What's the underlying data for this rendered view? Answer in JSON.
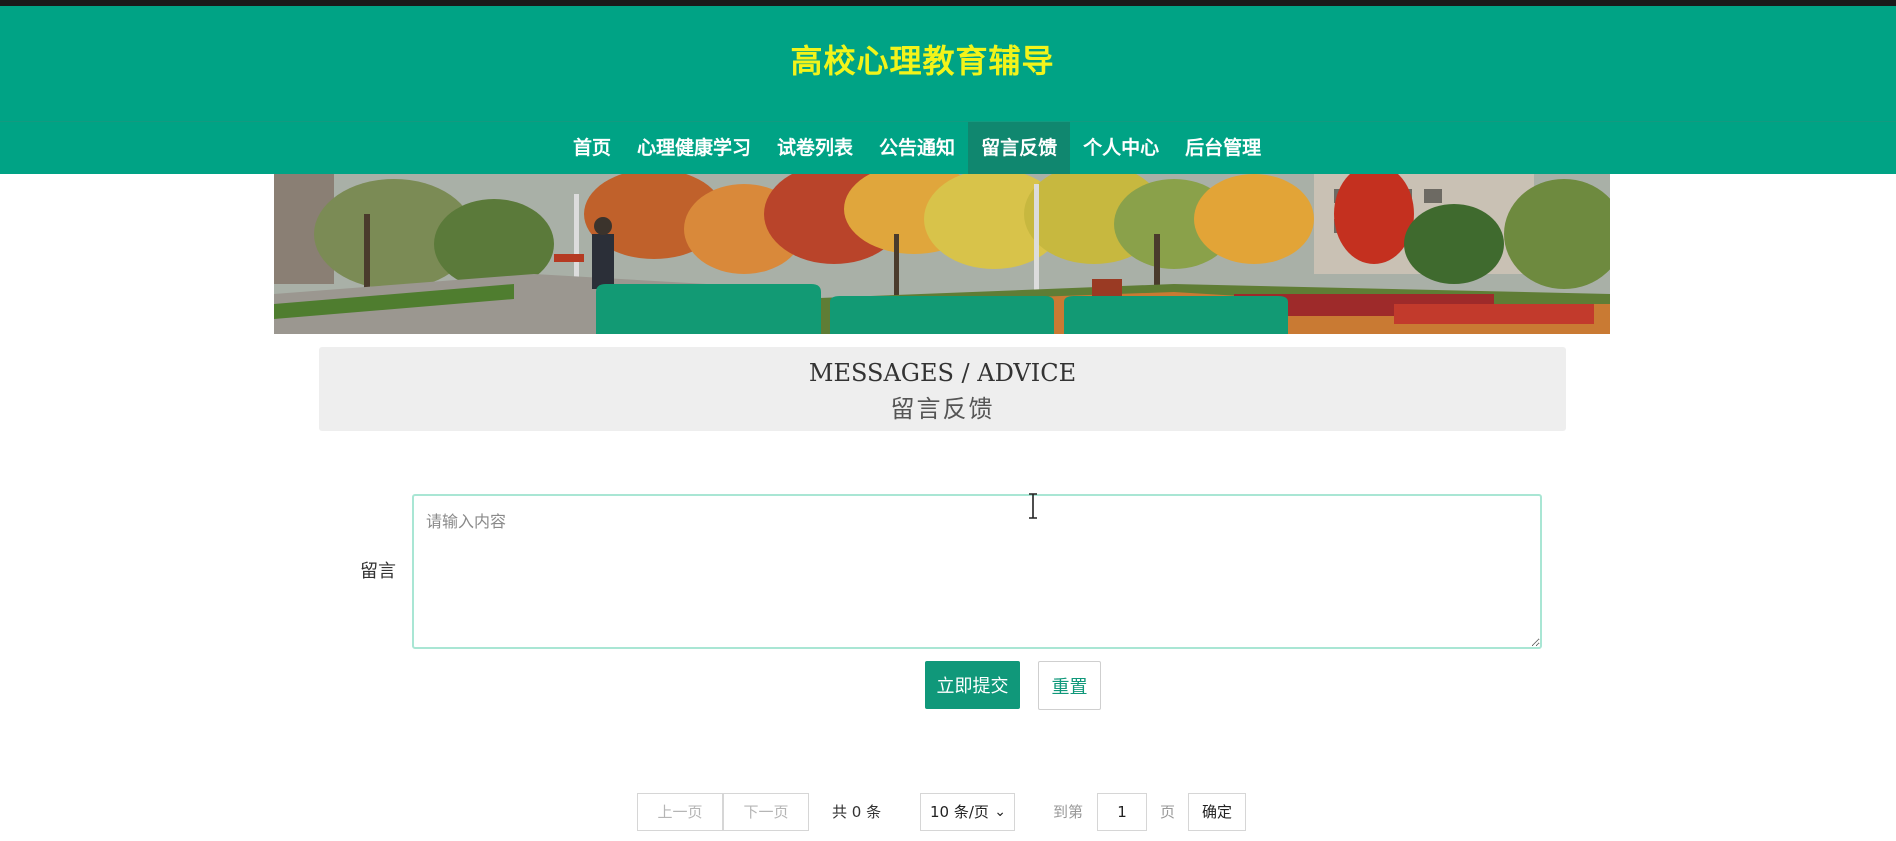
{
  "site": {
    "title": "高校心理教育辅导"
  },
  "nav": {
    "items": [
      {
        "label": "首页",
        "active": false
      },
      {
        "label": "心理健康学习",
        "active": false
      },
      {
        "label": "试卷列表",
        "active": false
      },
      {
        "label": "公告通知",
        "active": false
      },
      {
        "label": "留言反馈",
        "active": true
      },
      {
        "label": "个人中心",
        "active": false
      },
      {
        "label": "后台管理",
        "active": false
      }
    ]
  },
  "section": {
    "title_en": "MESSAGES / ADVICE",
    "title_cn": "留言反馈"
  },
  "form": {
    "label": "留言",
    "placeholder": "请输入内容",
    "submit_label": "立即提交",
    "reset_label": "重置"
  },
  "pagination": {
    "prev_label": "上一页",
    "next_label": "下一页",
    "total_text": "共 0 条",
    "page_size_label": "10 条/页",
    "goto_label": "到第",
    "page_value": "1",
    "page_unit": "页",
    "confirm_label": "确定"
  },
  "colors": {
    "header_bg": "#00a385",
    "title_color": "#f2f41a",
    "nav_active_bg": "#10876f",
    "accent": "#10987a"
  }
}
